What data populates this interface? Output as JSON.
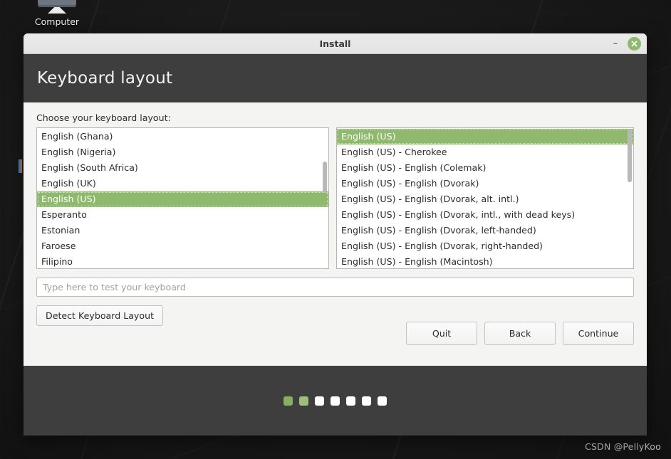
{
  "desktop": {
    "icon": {
      "name": "computer-icon",
      "label": "Computer"
    },
    "watermark": "CSDN @PellyKoo"
  },
  "window": {
    "titlebar": {
      "title": "Install",
      "minimize_label": "–",
      "close_label": "×"
    },
    "header": {
      "title": "Keyboard layout"
    },
    "content": {
      "choose_label": "Choose your keyboard layout:",
      "layout_list": {
        "selected": "English (US)",
        "items": [
          "English (Ghana)",
          "English (Nigeria)",
          "English (South Africa)",
          "English (UK)",
          "English (US)",
          "Esperanto",
          "Estonian",
          "Faroese",
          "Filipino"
        ]
      },
      "variant_list": {
        "selected": "English (US)",
        "items": [
          "English (US)",
          "English (US) - Cherokee",
          "English (US) - English (Colemak)",
          "English (US) - English (Dvorak)",
          "English (US) - English (Dvorak, alt. intl.)",
          "English (US) - English (Dvorak, intl., with dead keys)",
          "English (US) - English (Dvorak, left-handed)",
          "English (US) - English (Dvorak, right-handed)",
          "English (US) - English (Macintosh)"
        ]
      },
      "test_input": {
        "value": "",
        "placeholder": "Type here to test your keyboard"
      },
      "detect_button": "Detect Keyboard Layout",
      "actions": {
        "quit": "Quit",
        "back": "Back",
        "continue": "Continue"
      }
    },
    "footer": {
      "steps_total": 7,
      "steps_completed": 1,
      "current_step": 2
    }
  },
  "colors": {
    "accent_green": "#8fb96d",
    "header_dark": "#3e3e3e",
    "dialog_bg": "#f4f4f3",
    "desktop_bg": "#131313"
  }
}
